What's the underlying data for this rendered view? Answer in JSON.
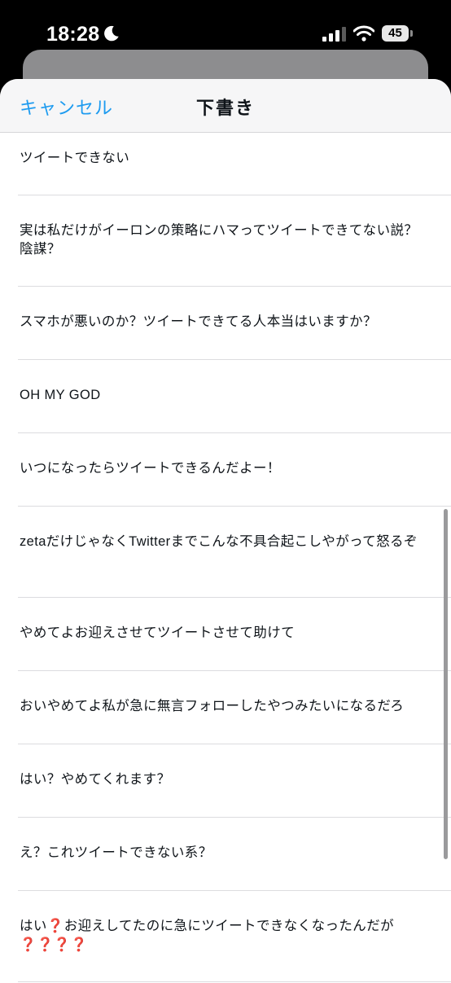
{
  "status_bar": {
    "time": "18:28",
    "battery": "45"
  },
  "nav": {
    "cancel_label": "キャンセル",
    "title": "下書き"
  },
  "drafts": [
    "ツイートできない",
    "実は私だけがイーロンの策略にハマってツイートできてない説？陰謀？",
    "スマホが悪いのか？ツイートできてる人本当はいますか？",
    "OH MY GOD",
    "いつになったらツイートできるんだよー！",
    "zetaだけじゃなくTwitterまでこんな不具合起こしやがって怒るぞ",
    "やめてよお迎えさせてツイートさせて助けて",
    "おいやめてよ私が急に無言フォローしたやつみたいになるだろ",
    "はい？やめてくれます？",
    "え？これツイートできない系？",
    "はい❓お迎えしてたのに急にツイートできなくなったんだが❓❓❓❓"
  ]
}
